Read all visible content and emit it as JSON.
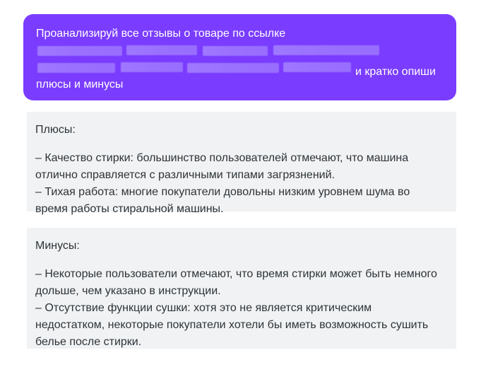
{
  "prompt": {
    "line1": "Проанализируй все отзывы о товаре по ссылке",
    "line2_tail": "и кратко опиши",
    "line3": "плюсы и минусы"
  },
  "pros": {
    "heading": "Плюсы:",
    "lines": [
      "– Качество стирки: большинство пользователей отмечают, что машина",
      "отлично справляется с различными типами загрязнений.",
      "– Тихая работа: многие покупатели довольны низким уровнем шума во",
      "время работы стиральной машины."
    ]
  },
  "cons": {
    "heading": "Минусы:",
    "lines": [
      "– Некоторые пользователи отмечают, что время стирки может быть немного",
      "дольше, чем указано в инструкции.",
      "– Отсутствие функции сушки: хотя это не является критическим",
      "недостатком, некоторые покупатели хотели бы иметь возможность сушить",
      "белье после стирки."
    ]
  },
  "colors": {
    "prompt_bg": "#7a3cff",
    "card_bg": "#f1f2f3",
    "text": "#2d3439"
  }
}
